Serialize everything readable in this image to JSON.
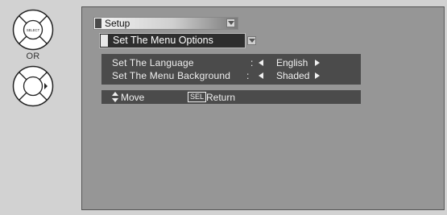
{
  "remote_hint": {
    "select_icon_label": "SELECT",
    "or_label": "OR"
  },
  "menu": {
    "title": "Setup",
    "submenu_title": "Set The Menu Options"
  },
  "options": [
    {
      "name": "Set The Language",
      "value": "English"
    },
    {
      "name": "Set The Menu Background",
      "value": "Shaded"
    }
  ],
  "separator": ":",
  "hints": {
    "move_label": "Move",
    "sel_key": "SEL",
    "return_label": "Return"
  }
}
